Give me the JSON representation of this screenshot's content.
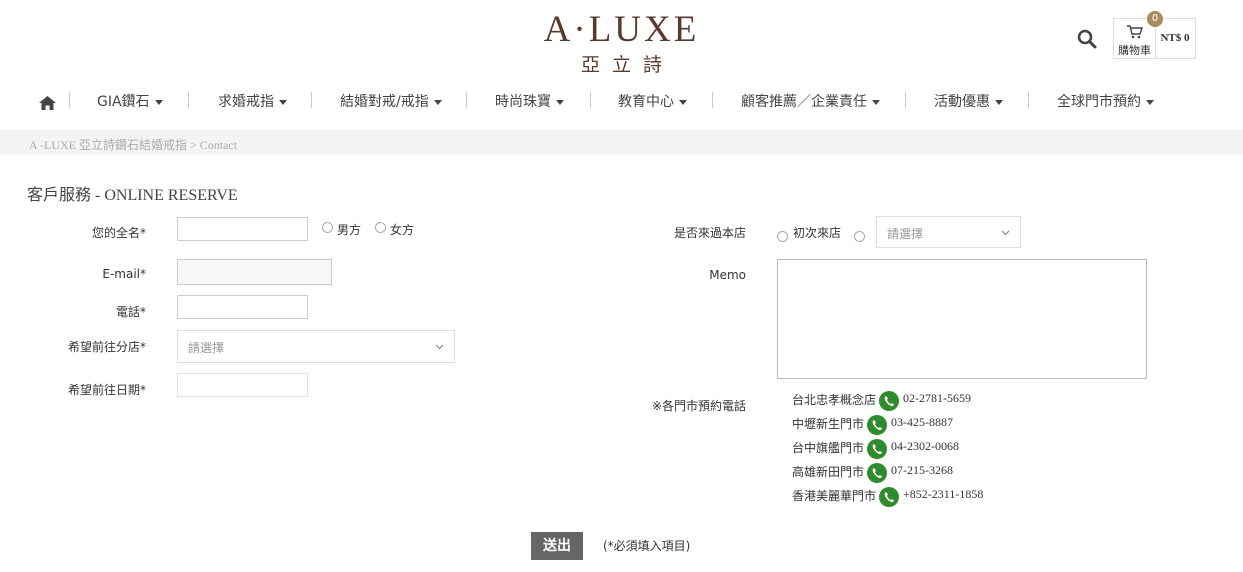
{
  "header": {
    "logo_main": "A·LUXE",
    "logo_sub": "亞立詩",
    "cart": {
      "label": "購物車",
      "count": "0",
      "total": "NT$ 0"
    }
  },
  "nav": {
    "items": [
      {
        "label": "GIA鑽石"
      },
      {
        "label": "求婚戒指"
      },
      {
        "label": "結婚對戒/戒指"
      },
      {
        "label": "時尚珠寶"
      },
      {
        "label": "教育中心"
      },
      {
        "label": "顧客推薦／企業責任"
      },
      {
        "label": "活動優惠"
      },
      {
        "label": "全球門市預約"
      }
    ]
  },
  "breadcrumb": {
    "text": "A -LUXE 亞立詩鑽石結婚戒指 > Contact"
  },
  "page": {
    "title": "客戶服務 - ONLINE RESERVE"
  },
  "form": {
    "name_label": "您的全名",
    "gender_male": "男方",
    "gender_female": "女方",
    "email_label": "E-mail",
    "phone_label": "電話",
    "branch_label": "希望前往分店",
    "branch_placeholder": "請選擇",
    "date_label": "希望前往日期",
    "required_mark": "*",
    "visited_label": "是否來過本店",
    "first_visit": "初次來店",
    "visited_placeholder": "請選擇",
    "memo_label": "Memo",
    "store_phone_label": "※各門市預約電話",
    "submit_label": "送出",
    "required_note": "(*必須填入項目)"
  },
  "stores": [
    {
      "name": "台北忠孝概念店",
      "phone": "02-2781-5659"
    },
    {
      "name": "中壢新生門市",
      "phone": "03-425-8887"
    },
    {
      "name": "台中旗艦門市",
      "phone": "04-2302-0068"
    },
    {
      "name": "高雄新田門市",
      "phone": "07-215-3268"
    },
    {
      "name": "香港美麗華門市",
      "phone": "+852-2311-1858"
    }
  ],
  "colors": {
    "brand": "#5a3a2c",
    "badge": "#a88d5c",
    "phone_icon": "#2e8b2e",
    "submit_bg": "#666666"
  }
}
